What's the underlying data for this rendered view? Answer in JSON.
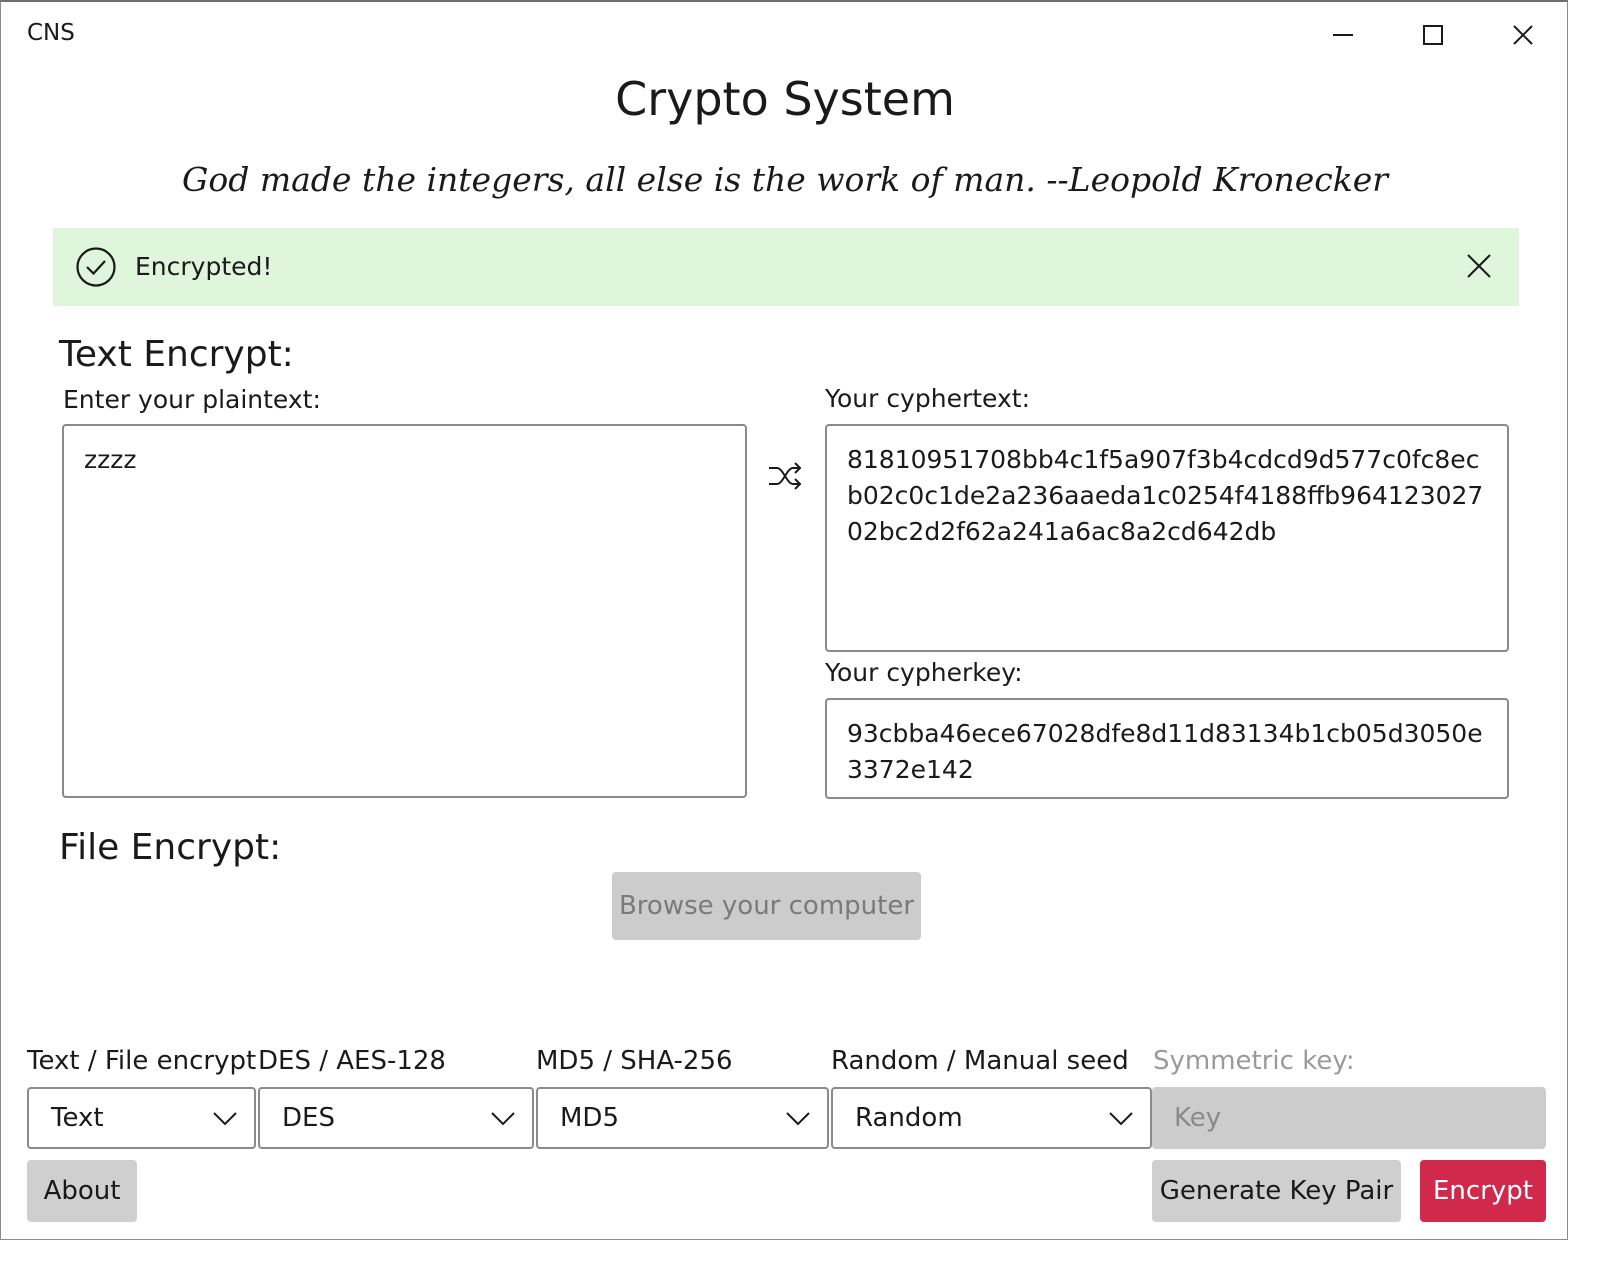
{
  "window": {
    "title": "CNS"
  },
  "header": {
    "title": "Crypto System",
    "quote": "God made the integers, all else is the work of man. --Leopold Kronecker"
  },
  "infobar": {
    "message": "Encrypted!",
    "status_color": "#dff6dd"
  },
  "text_encrypt": {
    "section_title": "Text Encrypt:",
    "plaintext_label": "Enter your plaintext:",
    "plaintext_value": "zzzz",
    "cyphertext_label": "Your cyphertext:",
    "cyphertext_value": "81810951708bb4c1f5a907f3b4cdcd9d577c0fc8ecb02c0c1de2a236aaeda1c0254f4188ffb96412302702bc2d2f62a241a6ac8a2cd642db",
    "cypherkey_label": "Your cypherkey:",
    "cypherkey_value": "93cbba46ece67028dfe8d11d83134b1cb05d3050e3372e142"
  },
  "file_encrypt": {
    "section_title": "File Encrypt:",
    "browse_label": "Browse your computer"
  },
  "options": {
    "mode_label": "Text / File encrypt",
    "mode_value": "Text",
    "cipher_label": "DES / AES-128",
    "cipher_value": "DES",
    "hash_label": "MD5 / SHA-256",
    "hash_value": "MD5",
    "seed_label": "Random / Manual seed",
    "seed_value": "Random",
    "key_label": "Symmetric key:",
    "key_placeholder": "Key"
  },
  "actions": {
    "about_label": "About",
    "generate_label": "Generate Key Pair",
    "encrypt_label": "Encrypt",
    "accent_color": "#d1294b"
  }
}
